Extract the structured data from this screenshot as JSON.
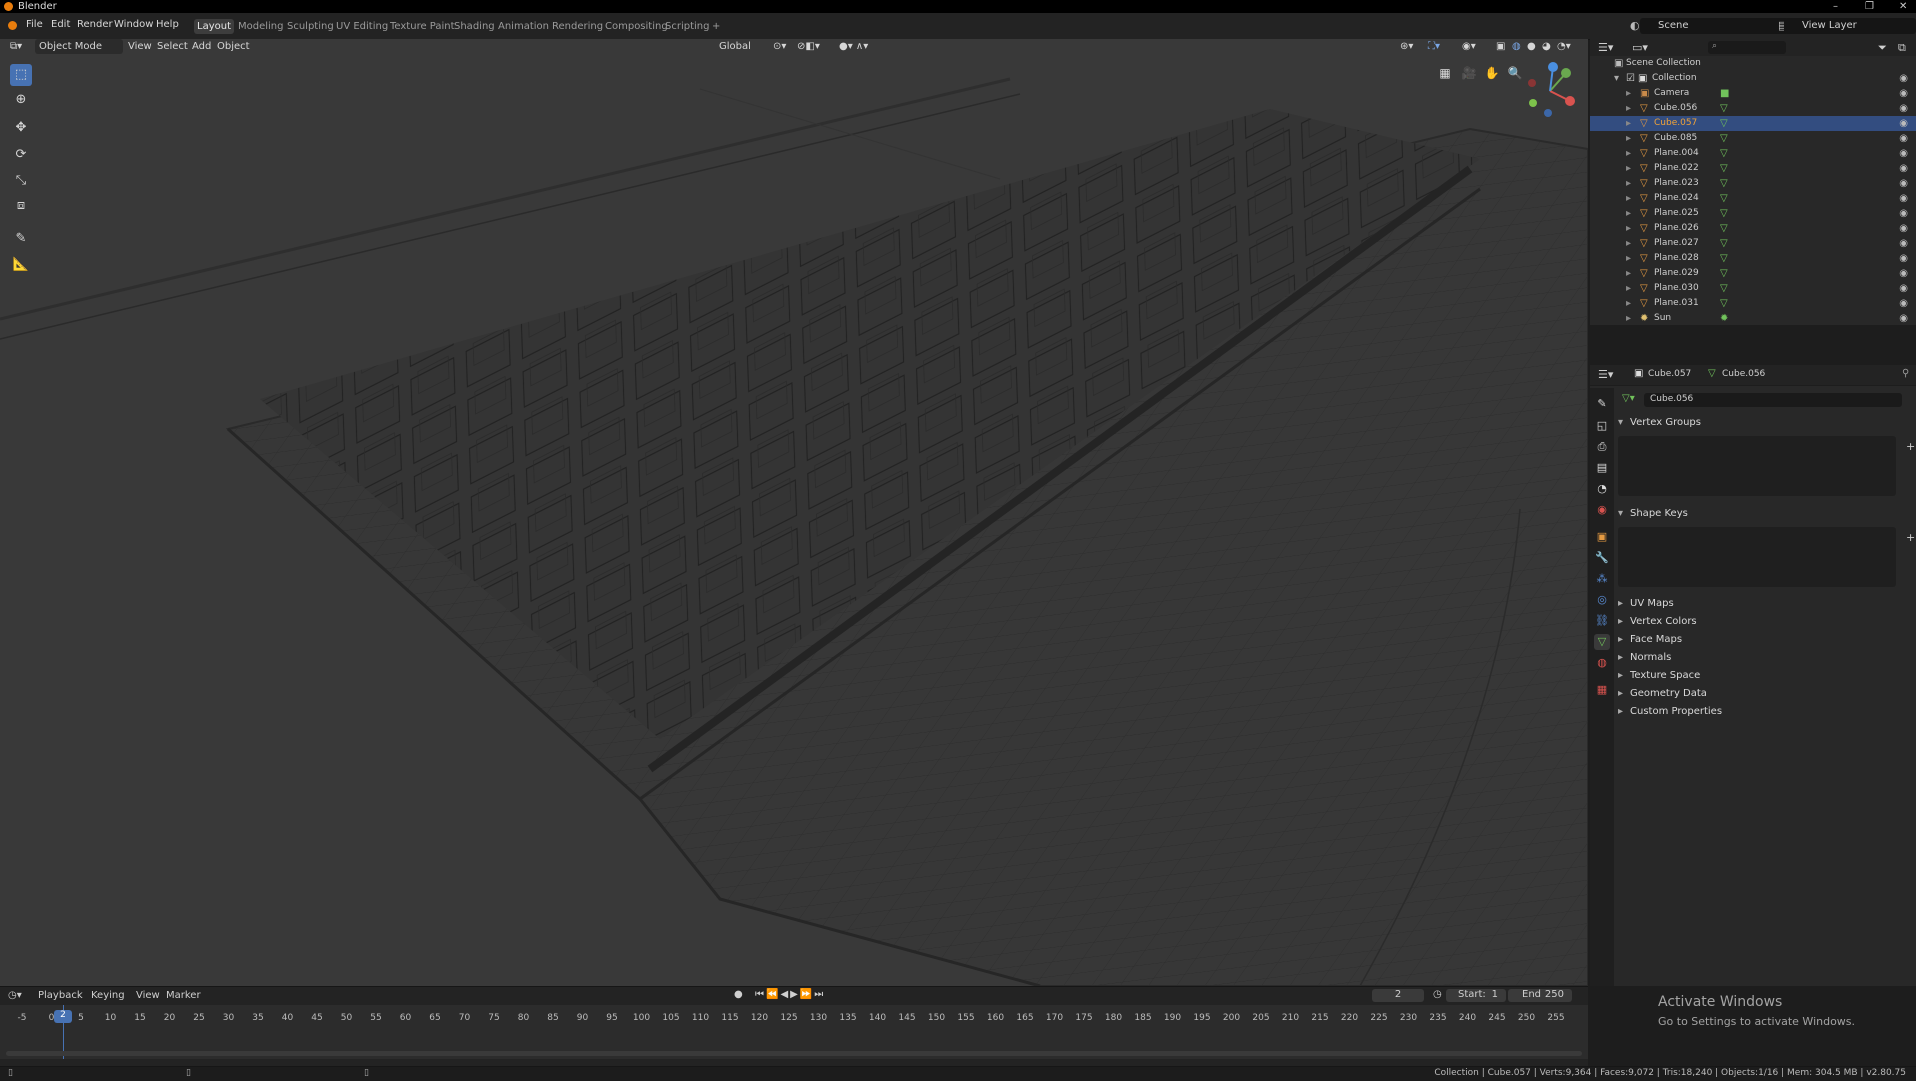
{
  "window": {
    "title": "Blender",
    "controls": [
      "–",
      "❐",
      "✕"
    ]
  },
  "menubar": {
    "items": [
      "File",
      "Edit",
      "Render",
      "Window",
      "Help"
    ],
    "workspaces": [
      "Layout",
      "Modeling",
      "Sculpting",
      "UV Editing",
      "Texture Paint",
      "Shading",
      "Animation",
      "Rendering",
      "Compositing",
      "Scripting",
      "+"
    ],
    "active_workspace": "Layout",
    "scene": "Scene",
    "view_layer": "View Layer"
  },
  "viewport": {
    "mode": "Object Mode",
    "menus": [
      "View",
      "Select",
      "Add",
      "Object"
    ],
    "transform_orientation": "Global"
  },
  "outliner": {
    "search_placeholder": "",
    "root": "Scene Collection",
    "collection": "Collection",
    "items": [
      {
        "name": "Camera",
        "type": "camera"
      },
      {
        "name": "Cube.056",
        "type": "mesh"
      },
      {
        "name": "Cube.057",
        "type": "mesh",
        "selected": true
      },
      {
        "name": "Cube.085",
        "type": "mesh"
      },
      {
        "name": "Plane.004",
        "type": "mesh"
      },
      {
        "name": "Plane.022",
        "type": "mesh"
      },
      {
        "name": "Plane.023",
        "type": "mesh"
      },
      {
        "name": "Plane.024",
        "type": "mesh"
      },
      {
        "name": "Plane.025",
        "type": "mesh"
      },
      {
        "name": "Plane.026",
        "type": "mesh"
      },
      {
        "name": "Plane.027",
        "type": "mesh"
      },
      {
        "name": "Plane.028",
        "type": "mesh"
      },
      {
        "name": "Plane.029",
        "type": "mesh"
      },
      {
        "name": "Plane.030",
        "type": "mesh"
      },
      {
        "name": "Plane.031",
        "type": "mesh"
      },
      {
        "name": "Sun",
        "type": "light"
      }
    ]
  },
  "properties": {
    "object": "Cube.057",
    "mesh": "Cube.056",
    "data_name": "Cube.056",
    "panels": {
      "vertex_groups": "Vertex Groups",
      "shape_keys": "Shape Keys",
      "uv_maps": "UV Maps",
      "vertex_colors": "Vertex Colors",
      "face_maps": "Face Maps",
      "normals": "Normals",
      "texture_space": "Texture Space",
      "geometry_data": "Geometry Data",
      "custom_properties": "Custom Properties"
    }
  },
  "timeline": {
    "menus": [
      "Playback",
      "Keying",
      "View",
      "Marker"
    ],
    "current_frame": "2",
    "start_label": "Start:",
    "start": "1",
    "end_label": "End",
    "end": "250",
    "ticks": [
      "-5",
      "0",
      "5",
      "10",
      "15",
      "20",
      "25",
      "30",
      "35",
      "40",
      "45",
      "50",
      "55",
      "60",
      "65",
      "70",
      "75",
      "80",
      "85",
      "90",
      "95",
      "100",
      "105",
      "110",
      "115",
      "120",
      "125",
      "130",
      "135",
      "140",
      "145",
      "150",
      "155",
      "160",
      "165",
      "170",
      "175",
      "180",
      "185",
      "190",
      "195",
      "200",
      "205",
      "210",
      "215",
      "220",
      "225",
      "230",
      "235",
      "240",
      "245",
      "250",
      "255"
    ]
  },
  "watermark": {
    "line1": "Activate Windows",
    "line2": "Go to Settings to activate Windows."
  },
  "statusbar": {
    "text": "Collection | Cube.057 | Verts:9,364 | Faces:9,072 | Tris:18,240 | Objects:1/16 | Mem: 304.5 MB | v2.80.75"
  },
  "colors": {
    "accent": "#4772b3",
    "selected_text": "#f0a338",
    "mesh_icon": "#e59a42",
    "data_icon": "#71c25b"
  }
}
